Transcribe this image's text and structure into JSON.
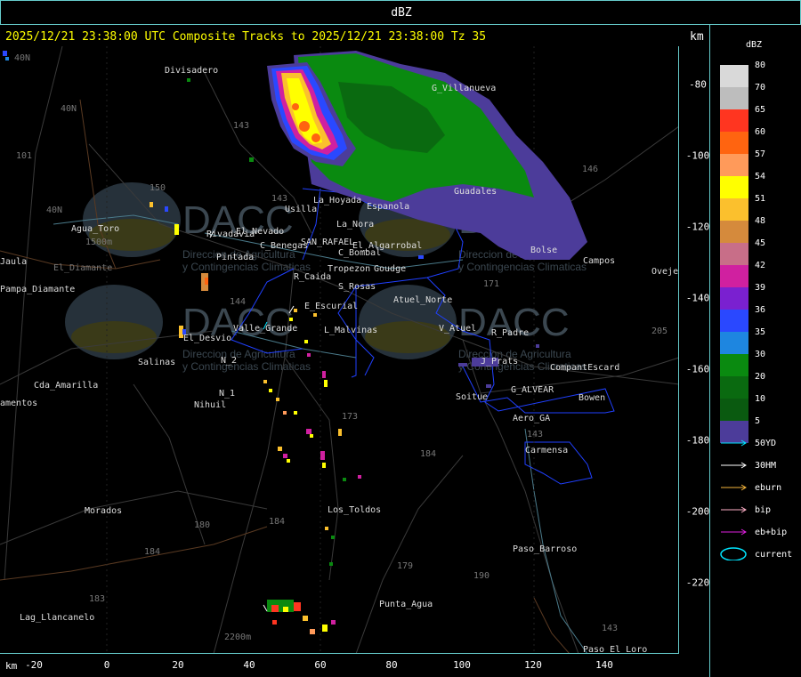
{
  "header": {
    "title": "dBZ",
    "status_line": "2025/12/21 23:38:00 UTC Composite Tracks to 2025/12/21 23:38:00 Tz 35",
    "km_top": "km",
    "km_bottom": "km"
  },
  "x_ticks": [
    "-20",
    "0",
    "20",
    "40",
    "60",
    "80",
    "100",
    "120",
    "140"
  ],
  "y_ticks": [
    "-80",
    "-100",
    "-120",
    "-140",
    "-160",
    "-180",
    "-200",
    "-220"
  ],
  "legend": {
    "title": "dBZ",
    "items": [
      {
        "label": "80",
        "color": "#d9d9d9"
      },
      {
        "label": "70",
        "color": "#bdbdbd"
      },
      {
        "label": "65",
        "color": "#ff3520"
      },
      {
        "label": "60",
        "color": "#ff6410"
      },
      {
        "label": "57",
        "color": "#ff9a5a"
      },
      {
        "label": "54",
        "color": "#ffff00"
      },
      {
        "label": "51",
        "color": "#fbc02d"
      },
      {
        "label": "48",
        "color": "#d58a3c"
      },
      {
        "label": "45",
        "color": "#c86e88"
      },
      {
        "label": "42",
        "color": "#d020a0"
      },
      {
        "label": "39",
        "color": "#7a20d0"
      },
      {
        "label": "36",
        "color": "#2a48ff"
      },
      {
        "label": "35",
        "color": "#1e86e0"
      },
      {
        "label": "30",
        "color": "#0a8a10"
      },
      {
        "label": "20",
        "color": "#0a6a10"
      },
      {
        "label": "10",
        "color": "#0a5a10"
      },
      {
        "label": "5",
        "color": "#4c3c9a"
      }
    ]
  },
  "tracks": [
    {
      "label": "50YD",
      "color": "#00e5ff"
    },
    {
      "label": "30HM",
      "color": "#ffffff"
    },
    {
      "label": "eburn",
      "color": "#f4b43c"
    },
    {
      "label": "bip",
      "color": "#ffb0c8"
    },
    {
      "label": "eb+bip",
      "color": "#e020e0"
    },
    {
      "label": "current",
      "color": "#00e5ff"
    }
  ],
  "places": [
    {
      "label": "Divisadero"
    },
    {
      "label": "G_Villanueva"
    },
    {
      "label": "Guadales"
    },
    {
      "label": "Usilla"
    },
    {
      "label": "La_Hoyada"
    },
    {
      "label": "Espanola"
    },
    {
      "label": "La_Nora"
    },
    {
      "label": "Agua_Toro"
    },
    {
      "label": "Rivadavia"
    },
    {
      "label": "El_Nevado"
    },
    {
      "label": "C_Benegas"
    },
    {
      "label": "SAN_RAFAEL"
    },
    {
      "label": "El_Algarrobal"
    },
    {
      "label": "C_Bombal"
    },
    {
      "label": "Pintada"
    },
    {
      "label": "Goudge"
    },
    {
      "label": "R_Caida"
    },
    {
      "label": "Tropezon"
    },
    {
      "label": "S_Rosas"
    },
    {
      "label": "Atuel_Norte"
    },
    {
      "label": "E_Escurial"
    },
    {
      "label": "Valle_Grande"
    },
    {
      "label": "L_Malvinas"
    },
    {
      "label": "V_Atuel"
    },
    {
      "label": "R_Padre"
    },
    {
      "label": "El_Desvio"
    },
    {
      "label": "Salinas"
    },
    {
      "label": "J_Prats"
    },
    {
      "label": "CompantEscard"
    },
    {
      "label": "Soitue"
    },
    {
      "label": "G_ALVEAR"
    },
    {
      "label": "Bowen"
    },
    {
      "label": "Aero_GA"
    },
    {
      "label": "Cda_Amarilla"
    },
    {
      "label": "N_1"
    },
    {
      "label": "N_2"
    },
    {
      "label": "Nihuil"
    },
    {
      "label": "Carmensa"
    },
    {
      "label": "Morados"
    },
    {
      "label": "Los_Toldos"
    },
    {
      "label": "Paso_Barroso"
    },
    {
      "label": "Punta_Agua"
    },
    {
      "label": "Lag_Llancanelo"
    },
    {
      "label": "Paso_El_Loro"
    },
    {
      "label": "Pampa_Diamante"
    },
    {
      "label": "El_Diamante"
    },
    {
      "label": "Jaula"
    },
    {
      "label": "amentos"
    },
    {
      "label": "Ovejer"
    },
    {
      "label": "Campos"
    },
    {
      "label": "Bolse"
    },
    {
      "label": "1500m"
    },
    {
      "label": "2200m"
    }
  ],
  "routes": [
    "40N",
    "101",
    "143",
    "143",
    "150",
    "144",
    "173",
    "171",
    "146",
    "184",
    "180",
    "184",
    "179",
    "190",
    "183",
    "184",
    "143",
    "143",
    "205",
    "40N",
    "40N"
  ],
  "watermark": {
    "brand": "DACC",
    "line1": "Direccion de Agricultura",
    "line2": "y Contingencias Climaticas"
  }
}
